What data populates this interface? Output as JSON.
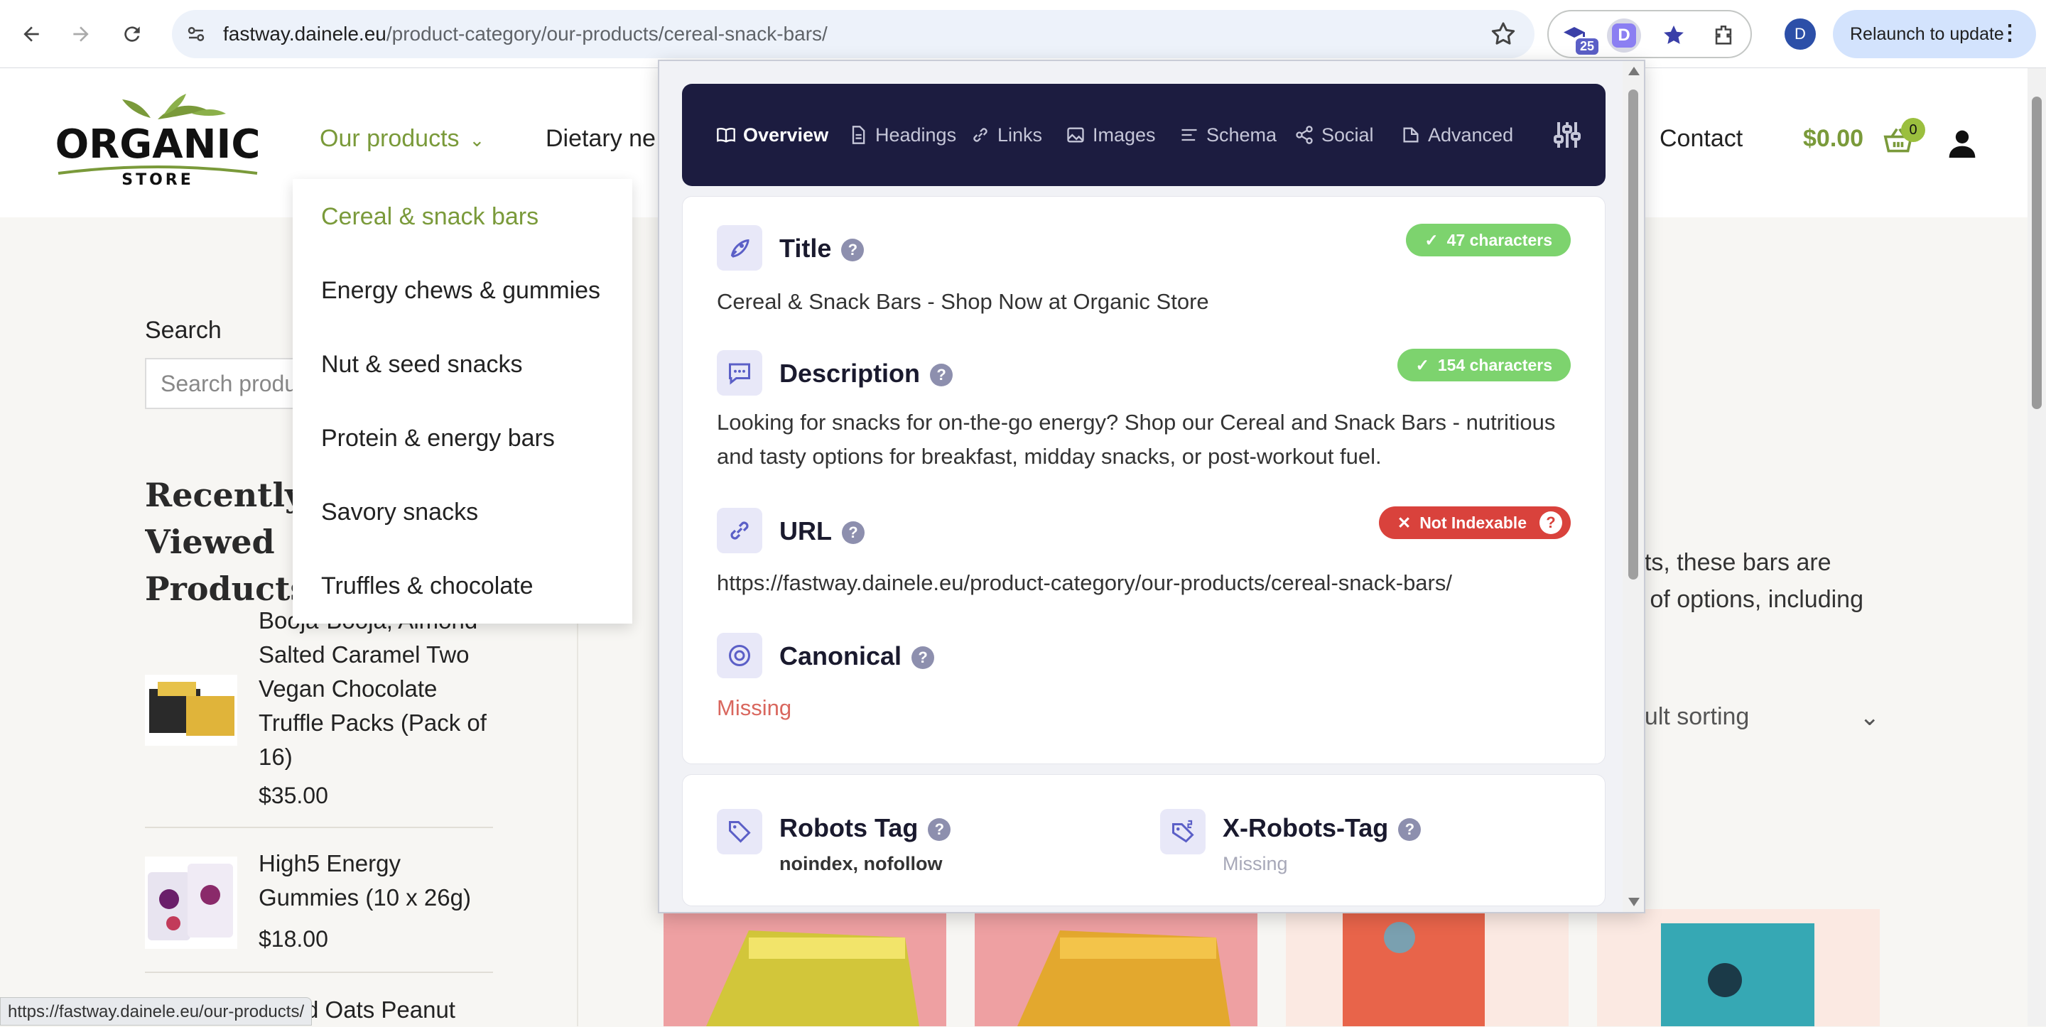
{
  "browser": {
    "url_domain": "fastway.dainele.eu",
    "url_path": "/product-category/our-products/cereal-snack-bars/",
    "ext_badge": "25",
    "ext_active_letter": "D",
    "profile_initial": "D",
    "relaunch_label": "Relaunch to update",
    "status_url": "https://fastway.dainele.eu/our-products/"
  },
  "site": {
    "logo_word": "ORGANIC",
    "logo_sub": "STORE",
    "menu": {
      "products": "Our products",
      "dietary": "Dietary ne",
      "contact": "Contact"
    },
    "cart_total": "$0.00",
    "cart_count": "0",
    "dropdown": [
      "Cereal & snack bars",
      "Energy chews & gummies",
      "Nut & seed snacks",
      "Protein & energy bars",
      "Savory snacks",
      "Truffles & chocolate"
    ],
    "search_label": "Search",
    "search_placeholder": "Search products…",
    "recent_title": "Recently Viewed Products",
    "recent_products": [
      {
        "name": "Booja-Booja, Almond Salted Caramel Two Vegan Chocolate Truffle Packs (Pack of 16)",
        "price": "$35.00"
      },
      {
        "name": "High5 Energy Gummies (10 x 26g)",
        "price": "$18.00"
      },
      {
        "name": "d Oats Peanut",
        "price": ""
      }
    ],
    "category_text": "nts, these bars are\ny of options, including",
    "sorting_label": "ault sorting"
  },
  "popup": {
    "tabs": [
      "Overview",
      "Headings",
      "Links",
      "Images",
      "Schema",
      "Social",
      "Advanced"
    ],
    "title": {
      "label": "Title",
      "badge": "47 characters",
      "value": "Cereal & Snack Bars - Shop Now at Organic Store"
    },
    "description": {
      "label": "Description",
      "badge": "154 characters",
      "value": "Looking for snacks for on-the-go energy? Shop our Cereal and Snack Bars - nutritious and tasty options for breakfast, midday snacks, or post-workout fuel."
    },
    "url": {
      "label": "URL",
      "badge": "Not Indexable",
      "value": "https://fastway.dainele.eu/product-category/our-products/cereal-snack-bars/"
    },
    "canonical": {
      "label": "Canonical",
      "value": "Missing"
    },
    "robots": {
      "label": "Robots Tag",
      "value": "noindex, nofollow"
    },
    "x_robots": {
      "label": "X-Robots-Tag",
      "value": "Missing"
    }
  },
  "colors": {
    "brand_green": "#7a9a3a",
    "popup_nav": "#1c1c40",
    "ok_badge": "#7dd36e",
    "error_badge": "#d9423c",
    "missing_text": "#d9675e"
  }
}
